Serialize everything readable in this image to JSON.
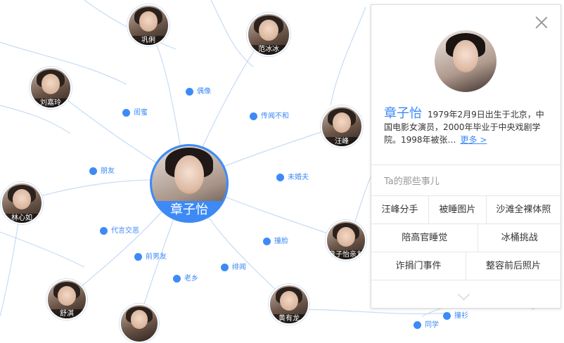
{
  "center": {
    "name": "章子怡"
  },
  "nodes": [
    {
      "name": "巩俐"
    },
    {
      "name": "范冰冰"
    },
    {
      "name": "刘嘉玲"
    },
    {
      "name": "汪峰"
    },
    {
      "name": "林心如"
    },
    {
      "name": "章子怡亲友"
    },
    {
      "name": "舒淇"
    },
    {
      "name": "黄有龙"
    },
    {
      "name": "撞衫"
    }
  ],
  "relations": [
    {
      "label": "偶像"
    },
    {
      "label": "闺蜜"
    },
    {
      "label": "传闻不和"
    },
    {
      "label": "朋友"
    },
    {
      "label": "未婚夫"
    },
    {
      "label": "代言交恶"
    },
    {
      "label": "撞脸"
    },
    {
      "label": "前男友"
    },
    {
      "label": "绯闻"
    },
    {
      "label": "老乡"
    },
    {
      "label": "撞衫"
    },
    {
      "label": "同学"
    }
  ],
  "panel": {
    "name": "章子怡",
    "bio": "1979年2月9日出生于北京，中国电影女演员，2000年毕业于中央戏剧学院。1998年被张…",
    "more_label": "更多 >",
    "section_title": "Ta的那些事儿",
    "events": [
      [
        "汪峰分手",
        "被睡图片",
        "沙滩全裸体照"
      ],
      [
        "陪高官睡觉",
        "冰桶挑战"
      ],
      [
        "诈捐门事件",
        "整容前后照片"
      ]
    ]
  }
}
